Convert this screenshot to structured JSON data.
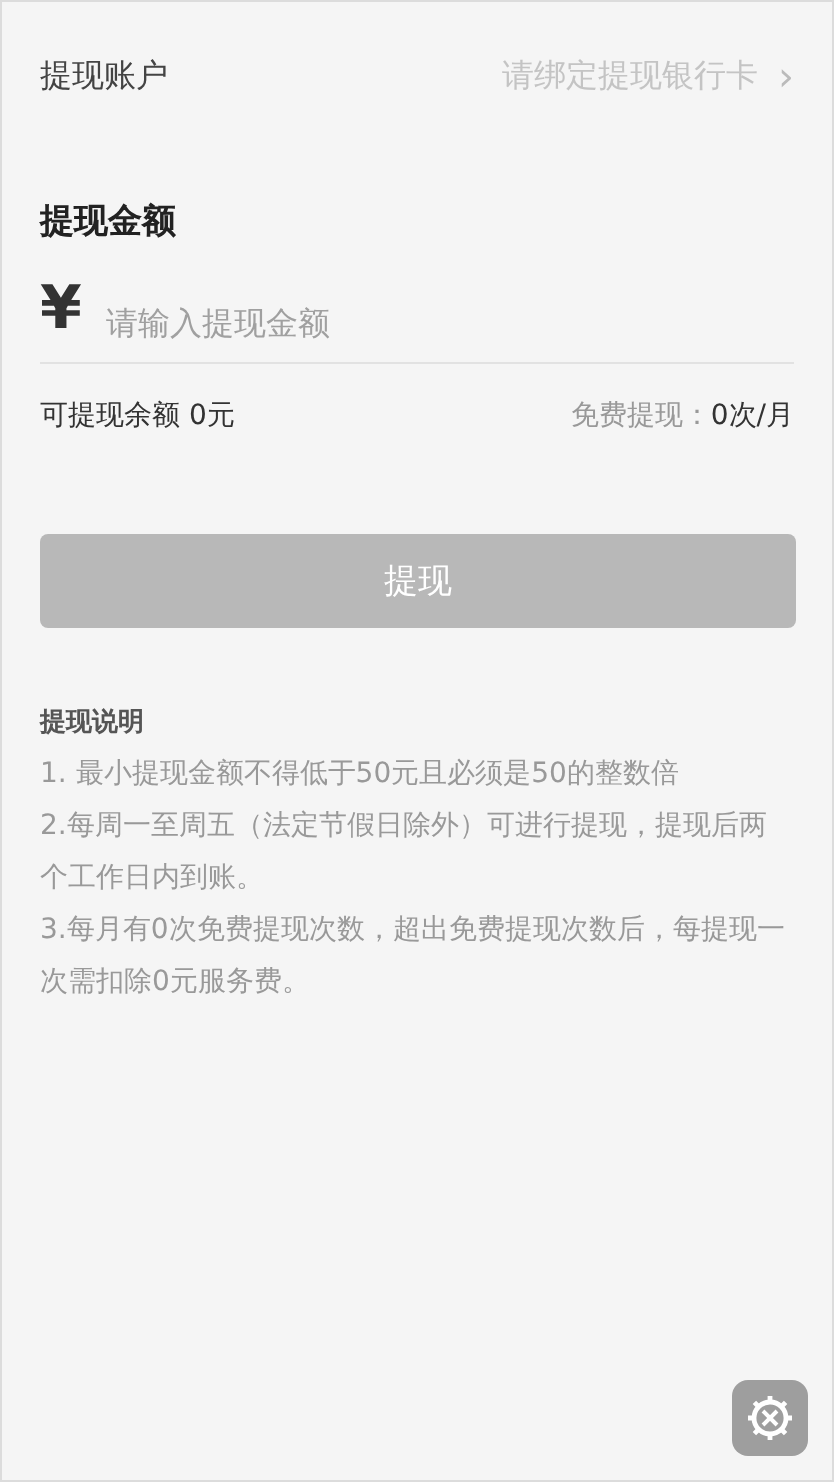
{
  "account_row": {
    "label": "提现账户",
    "value": "请绑定提现银行卡",
    "chevron": "›"
  },
  "amount": {
    "title": "提现金额",
    "currency": "¥",
    "placeholder": "请输入提现金额"
  },
  "balance": {
    "available": "可提现余额 0元",
    "free_label": "免费提现：",
    "free_value": "0次/月"
  },
  "submit_button": {
    "label": "提现",
    "disabled": true
  },
  "notes": {
    "title": "提现说明",
    "items": [
      "1. 最小提现金额不得低于50元且必须是50的整数倍",
      "2.每周一至周五（法定节假日除外）可进行提现，提现后两个工作日内到账。",
      "3.每月有0次免费提现次数，超出免费提现次数后，每提现一次需扣除0元服务费。"
    ]
  }
}
